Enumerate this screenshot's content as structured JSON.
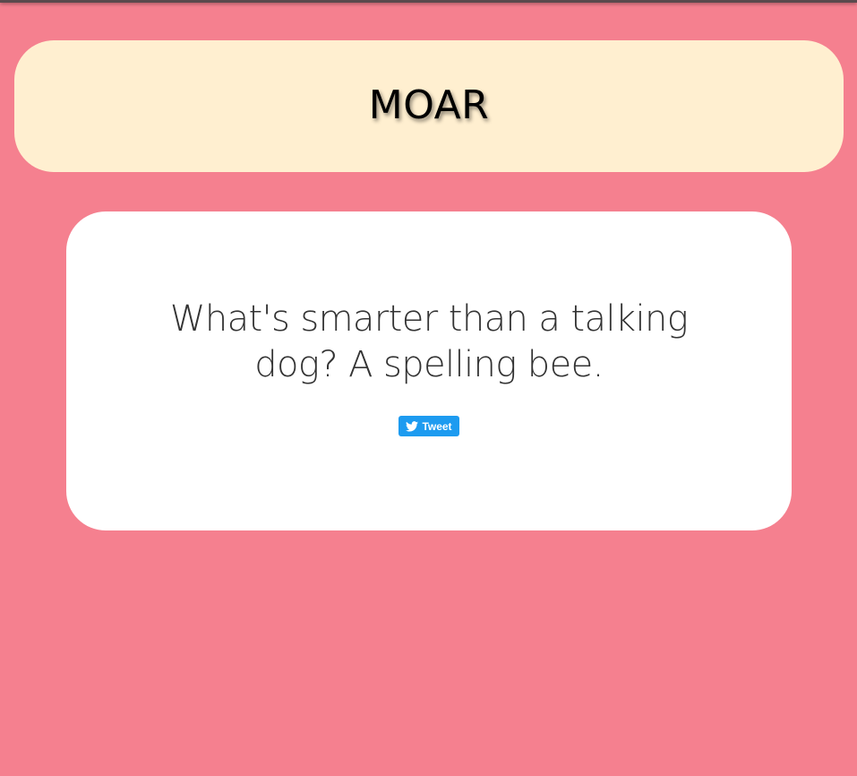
{
  "header": {
    "title": "MOAR"
  },
  "joke": {
    "text": "What's smarter than a talking dog? A spelling bee."
  },
  "tweet_button": {
    "label": "Tweet",
    "icon": "twitter-bird-icon"
  },
  "colors": {
    "page_background": "#f5808f",
    "header_background": "#ffefd0",
    "card_background": "#ffffff",
    "tweet_button": "#1d9bf0"
  }
}
